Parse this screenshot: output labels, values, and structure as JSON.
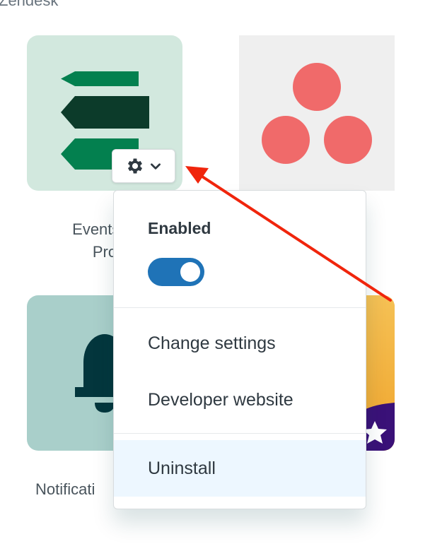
{
  "vendor_label": "Zendesk",
  "apps": [
    {
      "title": "Events Management Pro",
      "title_line1": "Events M",
      "title_line2": "Pro"
    },
    {
      "title": "Asana"
    },
    {
      "title": "Notifications",
      "title_visible": "Notificati"
    },
    {
      "title": "Starred app"
    }
  ],
  "gear_menu": {
    "button_icon": "gear-icon",
    "chevron_icon": "chevron-down-icon",
    "enabled_label": "Enabled",
    "enabled_state": true,
    "items": [
      {
        "label": "Change settings"
      },
      {
        "label": "Developer website"
      },
      {
        "label": "Uninstall",
        "highlighted": true
      }
    ]
  },
  "colors": {
    "toggle_on": "#1f73b7",
    "highlight": "#edf7ff",
    "annotation_arrow": "#f0250c",
    "asana": "#f06a6a"
  }
}
